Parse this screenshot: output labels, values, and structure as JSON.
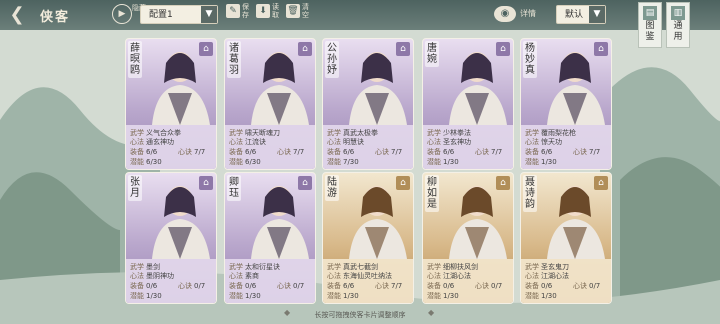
{
  "title": "侠客",
  "topbar": {
    "back_icon": "back-arrow-icon",
    "hide_label": "隐藏",
    "preset_select": "配置1",
    "save_label": "保存",
    "load_label": "读取",
    "clear_label": "清空",
    "detail_label": "详情",
    "sort_select": "默认"
  },
  "side": [
    {
      "label": "图鉴"
    },
    {
      "label": "通用"
    }
  ],
  "colors": {
    "purple_card": "#b9a7cc",
    "gold_card": "#d8b98a",
    "topbar": "#4d6360"
  },
  "labels": {
    "wuxue": "武学",
    "xinfa": "心法",
    "zhuangbei": "装备",
    "xinjue": "心诀",
    "qianneng": "潜能"
  },
  "cards": [
    {
      "name": "薛暝鸥",
      "sub": "引越",
      "rarity": "purple",
      "wuxue": "义气合众拳",
      "xinfa": "通玄神功",
      "zhuangbei": "6/6",
      "xinjue": "7/7",
      "qianneng": "6/30"
    },
    {
      "name": "诸葛羽",
      "sub": "",
      "rarity": "purple",
      "wuxue": "啸天断魂刀",
      "xinfa": "江流诀",
      "zhuangbei": "6/6",
      "xinjue": "7/7",
      "qianneng": "6/30"
    },
    {
      "name": "公孙妤",
      "sub": "",
      "rarity": "purple",
      "wuxue": "真武太极拳",
      "xinfa": "明慧诀",
      "zhuangbei": "6/6",
      "xinjue": "7/7",
      "qianneng": "7/30"
    },
    {
      "name": "唐婉",
      "sub": "",
      "rarity": "purple",
      "wuxue": "少林拳法",
      "xinfa": "圣玄神功",
      "zhuangbei": "6/6",
      "xinjue": "7/7",
      "qianneng": "1/30"
    },
    {
      "name": "杨妙真",
      "sub": "",
      "rarity": "purple",
      "wuxue": "覆雨梨花枪",
      "xinfa": "惊天功",
      "zhuangbei": "6/6",
      "xinjue": "7/7",
      "qianneng": "1/30"
    },
    {
      "name": "张月",
      "sub": "",
      "rarity": "purple",
      "wuxue": "墨剑",
      "xinfa": "墨阴神功",
      "zhuangbei": "0/6",
      "xinjue": "0/7",
      "qianneng": "1/30"
    },
    {
      "name": "卿珏",
      "sub": "",
      "rarity": "purple",
      "wuxue": "太和衍星诀",
      "xinfa": "素商",
      "zhuangbei": "0/6",
      "xinjue": "0/7",
      "qianneng": "1/30"
    },
    {
      "name": "陆游",
      "sub": "",
      "rarity": "gold",
      "wuxue": "真武七截剑",
      "xinfa": "东海仙灵吐纳法",
      "zhuangbei": "6/6",
      "xinjue": "7/7",
      "qianneng": "1/30"
    },
    {
      "name": "柳如是",
      "sub": "",
      "rarity": "gold",
      "wuxue": "细柳扶风剑",
      "xinfa": "江湖心法",
      "zhuangbei": "0/6",
      "xinjue": "0/7",
      "qianneng": "1/30"
    },
    {
      "name": "聂诗韵",
      "sub": "",
      "rarity": "gold",
      "wuxue": "圣玄鬼刀",
      "xinfa": "江湖心法",
      "zhuangbei": "0/6",
      "xinjue": "0/7",
      "qianneng": "1/30"
    }
  ],
  "hint": "长按可拖拽侠客卡片调整顺序"
}
